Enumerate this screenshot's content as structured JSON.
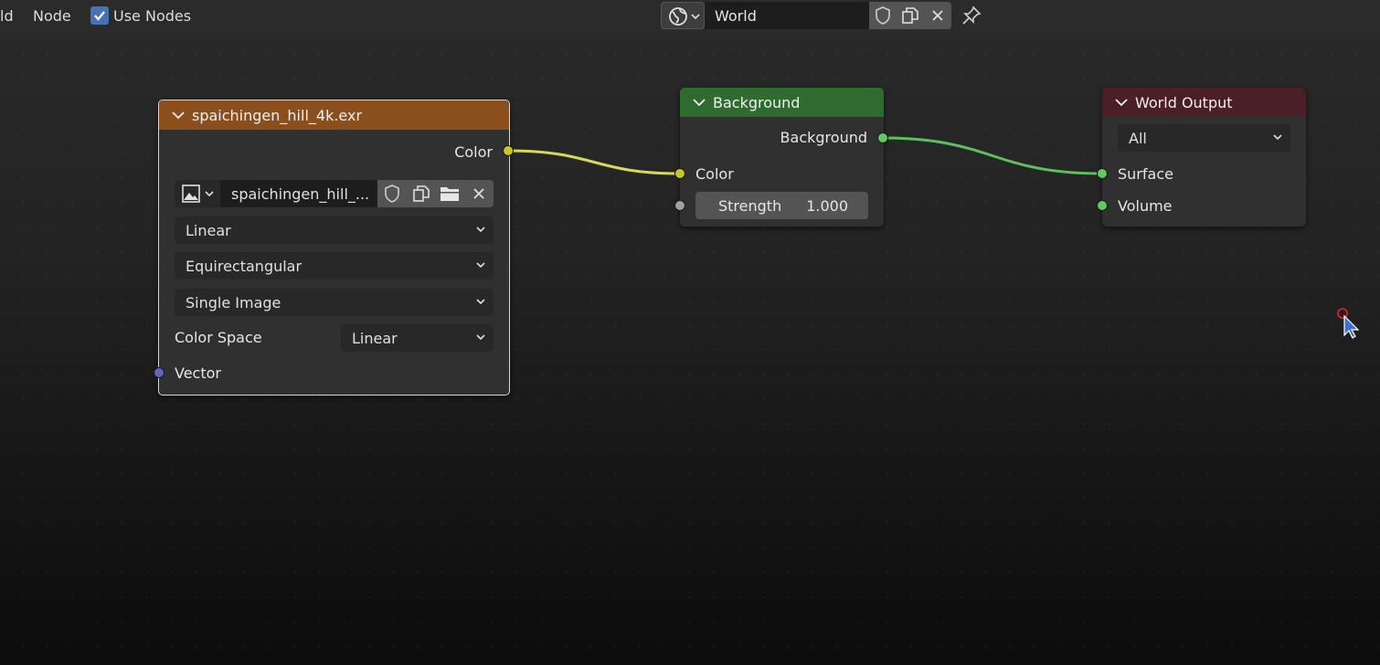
{
  "header": {
    "menu_partial": "ld",
    "node_menu": "Node",
    "use_nodes_label": "Use Nodes",
    "use_nodes_checked": true,
    "world_name": "World"
  },
  "image_node": {
    "title": "spaichingen_hill_4k.exr",
    "color_output": "Color",
    "image_name": "spaichingen_hill_...",
    "interpolation": "Linear",
    "projection": "Equirectangular",
    "source": "Single Image",
    "color_space_label": "Color Space",
    "color_space_value": "Linear",
    "vector_input": "Vector",
    "header_color": "#8a4f1c"
  },
  "background_node": {
    "title": "Background",
    "output": "Background",
    "color_input": "Color",
    "strength_label": "Strength",
    "strength_value": "1.000",
    "header_color": "#2f6b2f"
  },
  "output_node": {
    "title": "World Output",
    "target": "All",
    "surface_input": "Surface",
    "volume_input": "Volume",
    "header_color": "#4a1f27"
  },
  "colors": {
    "socket_color": "#c7c729",
    "socket_shader": "#63c763",
    "socket_vector": "#6363c7",
    "socket_float": "#a1a1a1",
    "accent": "#4772b3"
  },
  "icons": [
    "world-icon",
    "shield-icon",
    "duplicate-icon",
    "close-icon",
    "pin-icon",
    "image-icon",
    "folder-icon",
    "chevron-down-icon",
    "mouse-cursor-icon"
  ]
}
